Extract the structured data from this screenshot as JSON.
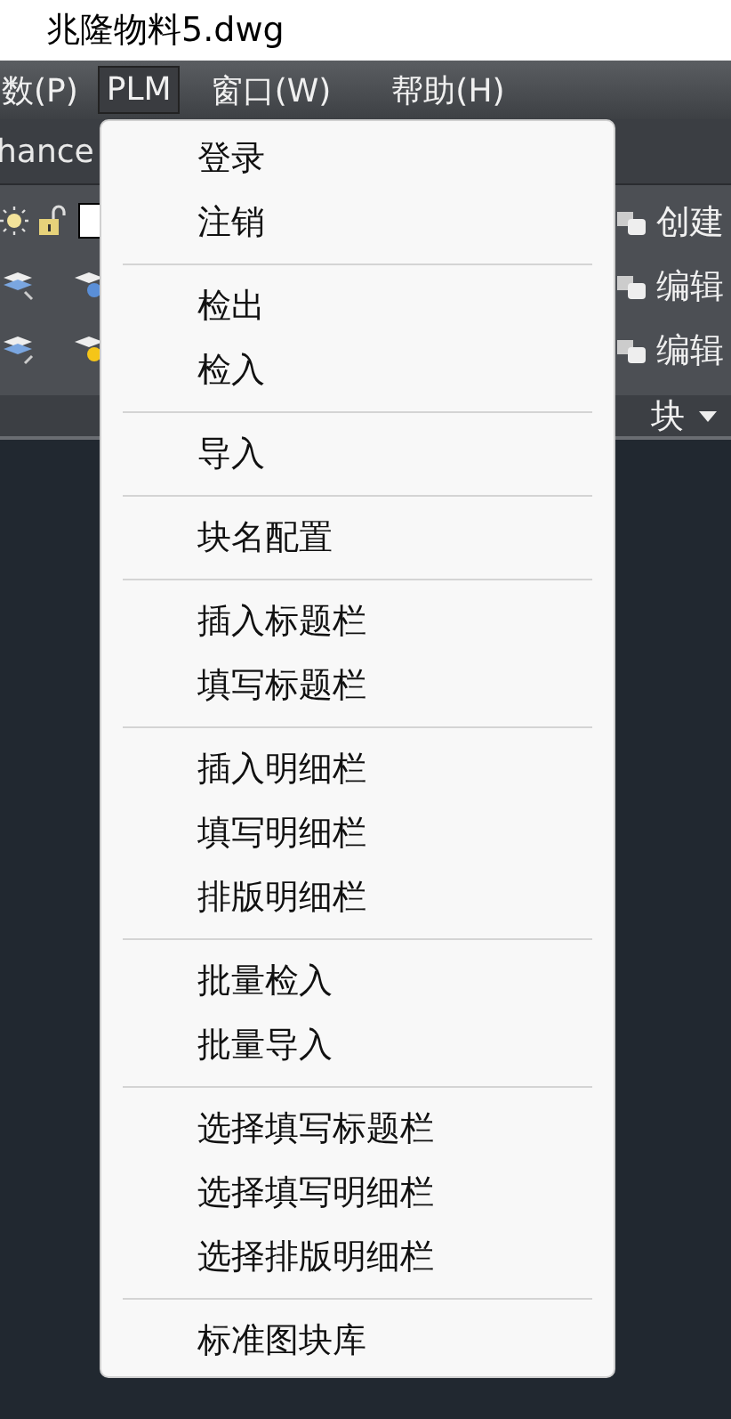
{
  "window": {
    "title": "兆隆物料5.dwg"
  },
  "menubar": [
    {
      "label": "数(P)",
      "selected": false
    },
    {
      "label": "PLM",
      "selected": true
    },
    {
      "label": "窗口(W)",
      "selected": false
    },
    {
      "label": "帮助(H)",
      "selected": false
    }
  ],
  "ribbon": {
    "tab_fragment": "hance",
    "tools": [
      "创建",
      "编辑",
      "编辑"
    ],
    "panel_title": "块"
  },
  "dropdown": {
    "groups": [
      [
        "登录",
        "注销"
      ],
      [
        "检出",
        "检入"
      ],
      [
        "导入"
      ],
      [
        "块名配置"
      ],
      [
        "插入标题栏",
        "填写标题栏"
      ],
      [
        "插入明细栏",
        "填写明细栏",
        "排版明细栏"
      ],
      [
        "批量检入",
        "批量导入"
      ],
      [
        "选择填写标题栏",
        "选择填写明细栏",
        "选择排版明细栏"
      ],
      [
        "标准图块库"
      ]
    ]
  }
}
